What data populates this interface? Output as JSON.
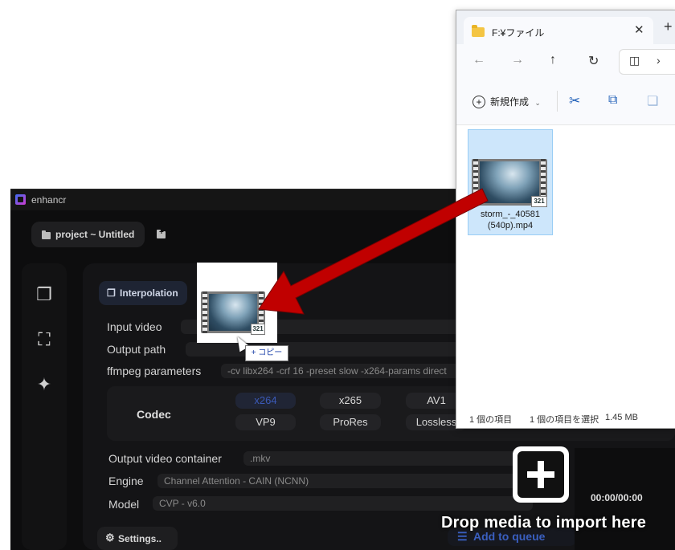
{
  "app": {
    "title": "enhancr",
    "project": "project ~ Untitled",
    "tab": "Interpolation",
    "fields": {
      "input_label": "Input video",
      "output_label": "Output path",
      "ffmpeg_label": "ffmpeg parameters",
      "ffmpeg_value": "-cv libx264 -crf 16 -preset slow -x264-params direct",
      "container_label": "Output video container",
      "container_value": ".mkv",
      "engine_label": "Engine",
      "engine_value": "Channel Attention - CAIN (NCNN)",
      "model_label": "Model",
      "model_value": "CVP - v6.0"
    },
    "codec": {
      "label": "Codec",
      "options": [
        "x264",
        "x265",
        "AV1",
        "VP9",
        "ProRes",
        "Lossless"
      ],
      "selected": "x264"
    },
    "settings_label": "Settings..",
    "queue_label": "Add to queue",
    "timecode": "00:00/00:00",
    "drop_text": "Drop media to import here"
  },
  "explorer": {
    "tab_title": "F:¥ファイル",
    "new_label": "新規作成",
    "file_name_1": "storm_-_40581",
    "file_name_2": "(540p).mp4",
    "status_count": "1 個の項目",
    "status_selected": "1 個の項目を選択",
    "status_size": "1.45 MB"
  },
  "drag": {
    "copy_label": "+ コピー"
  },
  "colors": {
    "arrow": "#c00000",
    "selection": "#cde6fb",
    "accent": "#3a5fc0"
  }
}
